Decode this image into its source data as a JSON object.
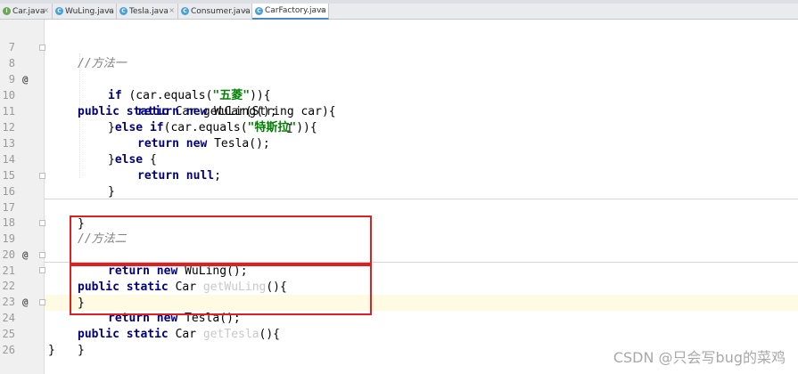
{
  "tabs": [
    {
      "label": "Car.java",
      "icon": "interface-icon"
    },
    {
      "label": "WuLing.java",
      "icon": "class-icon"
    },
    {
      "label": "Tesla.java",
      "icon": "class-icon"
    },
    {
      "label": "Consumer.java",
      "icon": "class-icon"
    },
    {
      "label": "CarFactory.java",
      "icon": "class-icon",
      "active": true
    }
  ],
  "code": {
    "l7": {
      "num": "7",
      "comment": "//方法一"
    },
    "l8": {
      "num": "8",
      "mark": "@",
      "kw1": "public",
      "kw2": "static",
      "rest": " Car getCar(String car){"
    },
    "l9": {
      "num": "9",
      "kw": "if",
      "pre": " (car.equals(",
      "str": "\"五菱\"",
      "post": ")){"
    },
    "l10": {
      "num": "10",
      "kw1": "return",
      "kw2": "new",
      "rest": " WuLing();"
    },
    "l11": {
      "num": "11",
      "pre": "}",
      "kw1": "else",
      "kw2": "if",
      "mid": "(car.equals(",
      "str": "\"特斯拉\"",
      "post": ")){"
    },
    "l12": {
      "num": "12",
      "kw1": "return",
      "kw2": "new",
      "rest": " Tesla();"
    },
    "l13": {
      "num": "13",
      "pre": "}",
      "kw": "else",
      "post": " {"
    },
    "l14": {
      "num": "14",
      "kw1": "return",
      "kw2": "null",
      "post": ";"
    },
    "l15": {
      "num": "15",
      "text": "}"
    },
    "l16": {
      "num": "16",
      "text": "}"
    },
    "l17": {
      "num": "17"
    },
    "l18": {
      "num": "18",
      "comment": "//方法二"
    },
    "l19": {
      "num": "19",
      "mark": "@",
      "kw1": "public",
      "kw2": "static",
      "mid": " Car ",
      "faded": "getWuLing",
      "post": "(){"
    },
    "l20": {
      "num": "20",
      "kw1": "return",
      "kw2": "new",
      "rest": " WuLing();"
    },
    "l21": {
      "num": "21",
      "text": "}"
    },
    "l22": {
      "num": "22",
      "mark": "@",
      "kw1": "public",
      "kw2": "static",
      "mid": " Car ",
      "faded": "getTesla",
      "post": "(){"
    },
    "l23": {
      "num": "23",
      "kw1": "return",
      "kw2": "new",
      "rest": " Tesla();"
    },
    "l24": {
      "num": "24",
      "text": "}"
    },
    "l25": {
      "num": "25",
      "text": "}"
    },
    "l26": {
      "num": "26"
    }
  },
  "watermark": "CSDN @只会写bug的菜鸡",
  "colors": {
    "keyword": "#000080",
    "string": "#008000",
    "comment": "#808080",
    "highlight_box": "#e02020"
  }
}
